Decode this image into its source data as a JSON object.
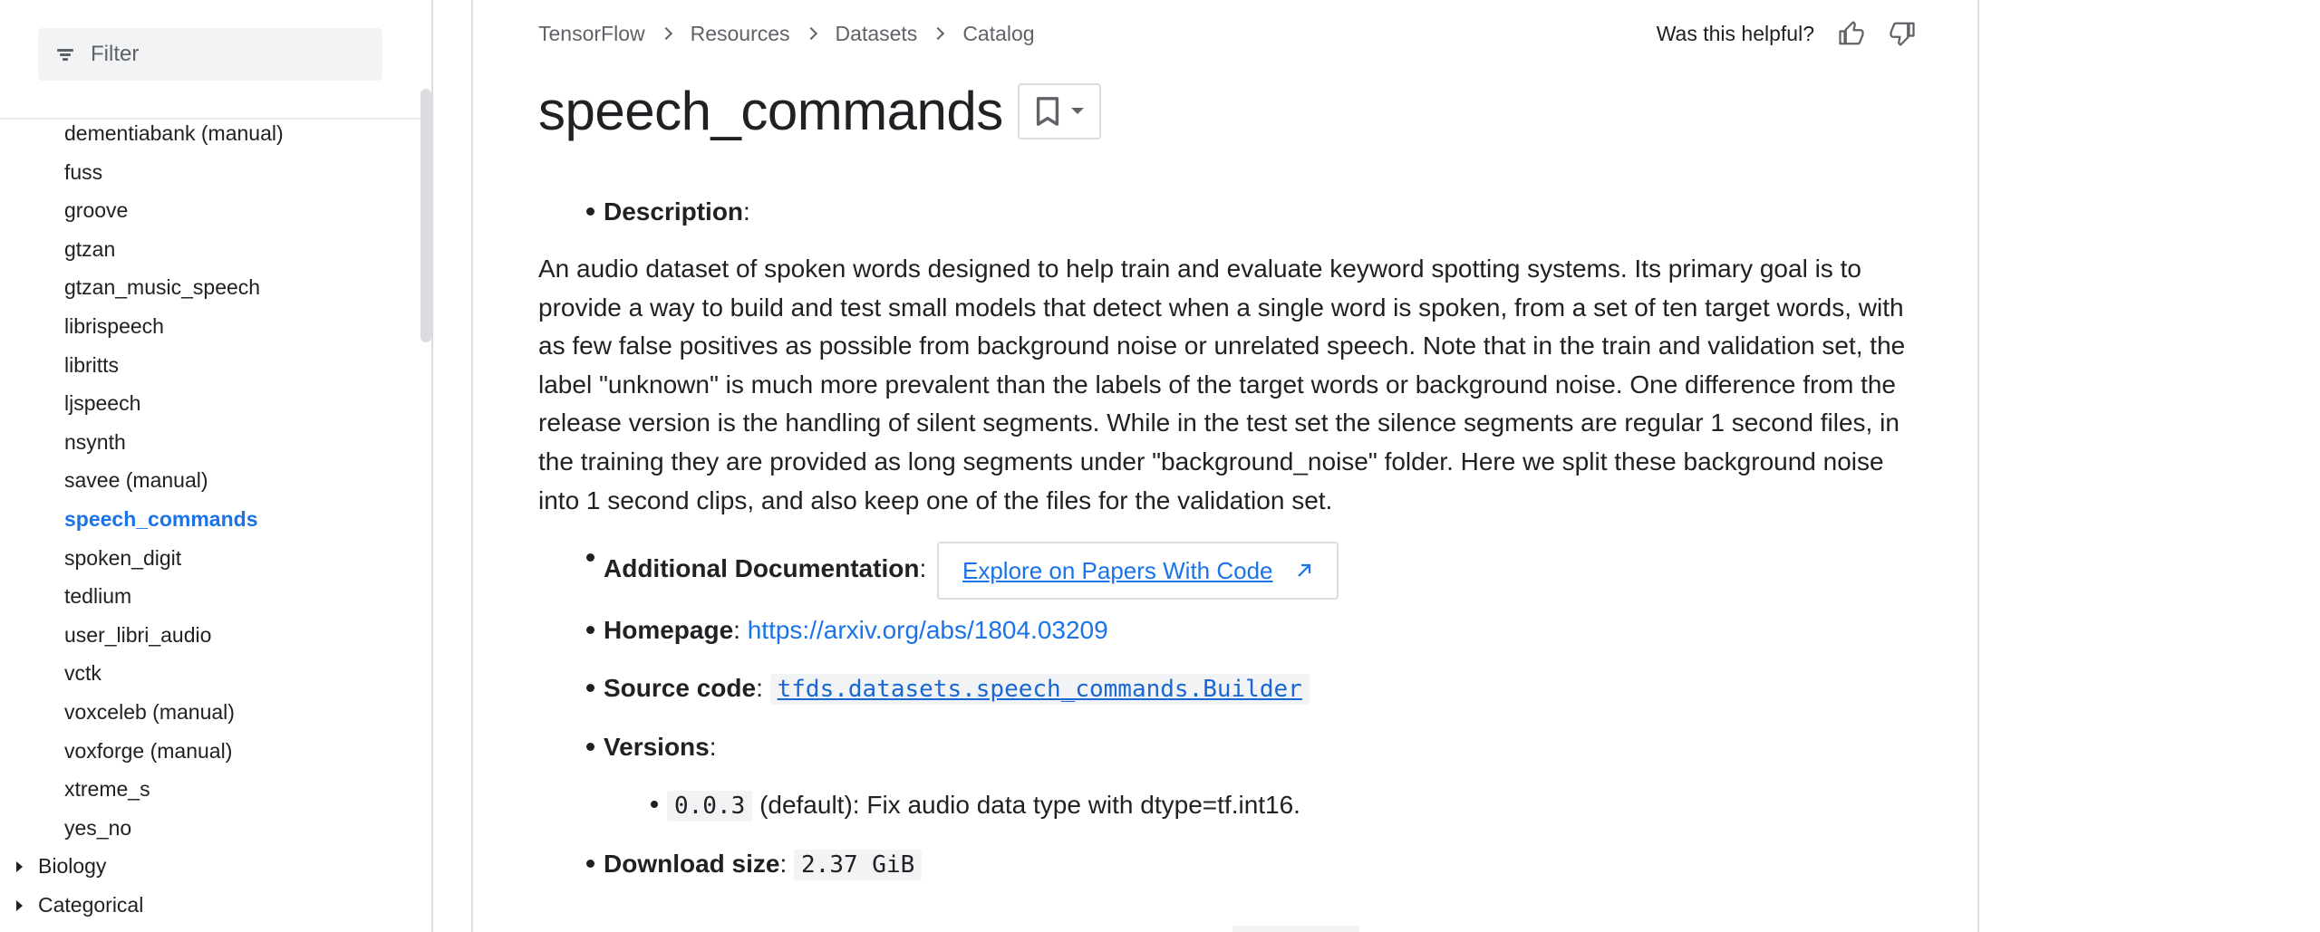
{
  "sidebar": {
    "filter_placeholder": "Filter",
    "items": [
      {
        "label": "dementiabank (manual)"
      },
      {
        "label": "fuss"
      },
      {
        "label": "groove"
      },
      {
        "label": "gtzan"
      },
      {
        "label": "gtzan_music_speech"
      },
      {
        "label": "librispeech"
      },
      {
        "label": "libritts"
      },
      {
        "label": "ljspeech"
      },
      {
        "label": "nsynth"
      },
      {
        "label": "savee (manual)"
      },
      {
        "label": "speech_commands"
      },
      {
        "label": "spoken_digit"
      },
      {
        "label": "tedlium"
      },
      {
        "label": "user_libri_audio"
      },
      {
        "label": "vctk"
      },
      {
        "label": "voxceleb (manual)"
      },
      {
        "label": "voxforge (manual)"
      },
      {
        "label": "xtreme_s"
      },
      {
        "label": "yes_no"
      }
    ],
    "categories": [
      {
        "label": "Biology"
      },
      {
        "label": "Categorical"
      }
    ]
  },
  "breadcrumb": [
    "TensorFlow",
    "Resources",
    "Datasets",
    "Catalog"
  ],
  "helpful": {
    "label": "Was this helpful?"
  },
  "page": {
    "title": "speech_commands",
    "description_label": "Description",
    "description_text": "An audio dataset of spoken words designed to help train and evaluate keyword spotting systems. Its primary goal is to provide a way to build and test small models that detect when a single word is spoken, from a set of ten target words, with as few false positives as possible from background noise or unrelated speech. Note that in the train and validation set, the label \"unknown\" is much more prevalent than the labels of the target words or background noise. One difference from the release version is the handling of silent segments. While in the test set the silence segments are regular 1 second files, in the training they are provided as long segments under \"background_noise\" folder. Here we split these background noise into 1 second clips, and also keep one of the files for the validation set.",
    "additional_doc_label": "Additional Documentation",
    "additional_doc_button": "Explore on Papers With Code",
    "homepage_label": "Homepage",
    "homepage_url": "https://arxiv.org/abs/1804.03209",
    "source_code_label": "Source code",
    "source_code_value": "tfds.datasets.speech_commands.Builder",
    "versions_label": "Versions",
    "version_value": "0.0.3",
    "version_note": "(default): Fix audio data type with dtype=tf.int16.",
    "download_size_label": "Download size",
    "download_size_value": "2.37 GiB",
    "colon": ":"
  },
  "colors": {
    "accent": "#1a73e8",
    "active_bg": "#e8f0fe",
    "text": "#202124",
    "muted": "#5f6368"
  }
}
